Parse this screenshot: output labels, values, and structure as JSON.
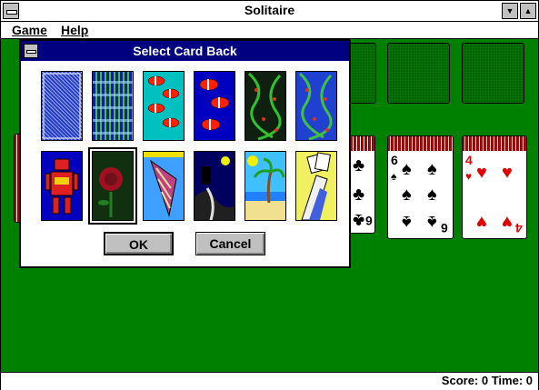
{
  "window": {
    "title": "Solitaire",
    "minimize_glyph": "▼",
    "maximize_glyph": "▲"
  },
  "menu": {
    "game": "Game",
    "help": "Help"
  },
  "status": {
    "score_text": "Score: 0 Time: 0"
  },
  "dialog": {
    "title": "Select Card Back",
    "ok_label": "OK",
    "cancel_label": "Cancel",
    "card_backs": [
      {
        "name": "blue-crosshatch-back",
        "selected": false
      },
      {
        "name": "green-weave-back",
        "selected": false
      },
      {
        "name": "clownfish-cyan-back",
        "selected": false
      },
      {
        "name": "clownfish-blue-back",
        "selected": false
      },
      {
        "name": "green-vines-black-back",
        "selected": false
      },
      {
        "name": "green-vines-blue-back",
        "selected": false
      },
      {
        "name": "robot-back",
        "selected": false
      },
      {
        "name": "roses-back",
        "selected": true
      },
      {
        "name": "seashell-back",
        "selected": false
      },
      {
        "name": "castle-back",
        "selected": false
      },
      {
        "name": "beach-palm-back",
        "selected": false
      },
      {
        "name": "magician-hand-back",
        "selected": false
      }
    ]
  },
  "tableau": {
    "card_6s": {
      "rank": "6",
      "suit": "♠"
    },
    "card_4h": {
      "rank": "4",
      "suit": "♥"
    },
    "card_6c": {
      "rank": "6",
      "suit": "♣"
    }
  },
  "colors": {
    "felt": "#008000",
    "dialog_title": "#000080"
  }
}
